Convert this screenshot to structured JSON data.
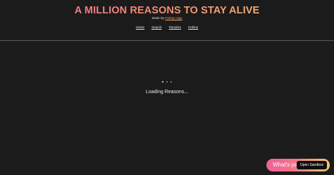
{
  "header": {
    "title": "A MILLION REASONS TO STAY ALIVE",
    "byline_prefix": "Made By",
    "byline_author": "Farhan Ajay"
  },
  "nav": {
    "items": [
      {
        "label": "Home"
      },
      {
        "label": "Search"
      },
      {
        "label": "Random"
      },
      {
        "label": "Hotline"
      }
    ]
  },
  "main": {
    "loading_text": "Loading Reasons..."
  },
  "sandbox": {
    "tease_text": "What's yo",
    "button_label": "Open Sandbox"
  },
  "colors": {
    "background": "#1b1b1b",
    "title_gradient_start": "#f36a8f",
    "title_gradient_end": "#f7c46c",
    "author_link": "#f3a46b"
  }
}
